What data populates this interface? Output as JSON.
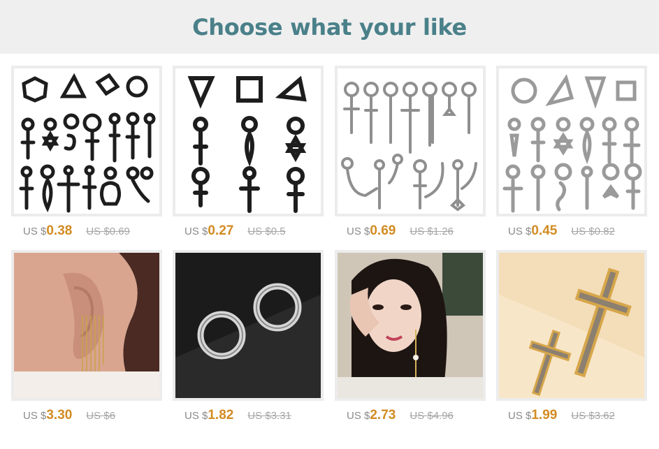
{
  "header": {
    "title": "Choose what your like"
  },
  "colors": {
    "title": "#4a8089",
    "price": "#d28b22",
    "old_price": "#a5a5a5",
    "header_bg": "#efefef"
  },
  "products": [
    {
      "currency": "US $",
      "price": "0.38",
      "old_price": "US $0.69",
      "image": "black-stud-set-icon"
    },
    {
      "currency": "US $",
      "price": "0.27",
      "old_price": "US $0.5",
      "image": "black-geometric-earrings-icon"
    },
    {
      "currency": "US $",
      "price": "0.69",
      "old_price": "US $1.26",
      "image": "silver-hoop-chain-set-icon"
    },
    {
      "currency": "US $",
      "price": "0.45",
      "old_price": "US $0.82",
      "image": "silver-stud-set-icon"
    },
    {
      "currency": "US $",
      "price": "3.30",
      "old_price": "US $6",
      "image": "tassel-ear-cuff-photo"
    },
    {
      "currency": "US $",
      "price": "1.82",
      "old_price": "US $3.31",
      "image": "silver-hoops-photo"
    },
    {
      "currency": "US $",
      "price": "2.73",
      "old_price": "US $4.96",
      "image": "model-chain-earring-photo"
    },
    {
      "currency": "US $",
      "price": "1.99",
      "old_price": "US $3.62",
      "image": "gold-cross-earrings-photo"
    }
  ]
}
